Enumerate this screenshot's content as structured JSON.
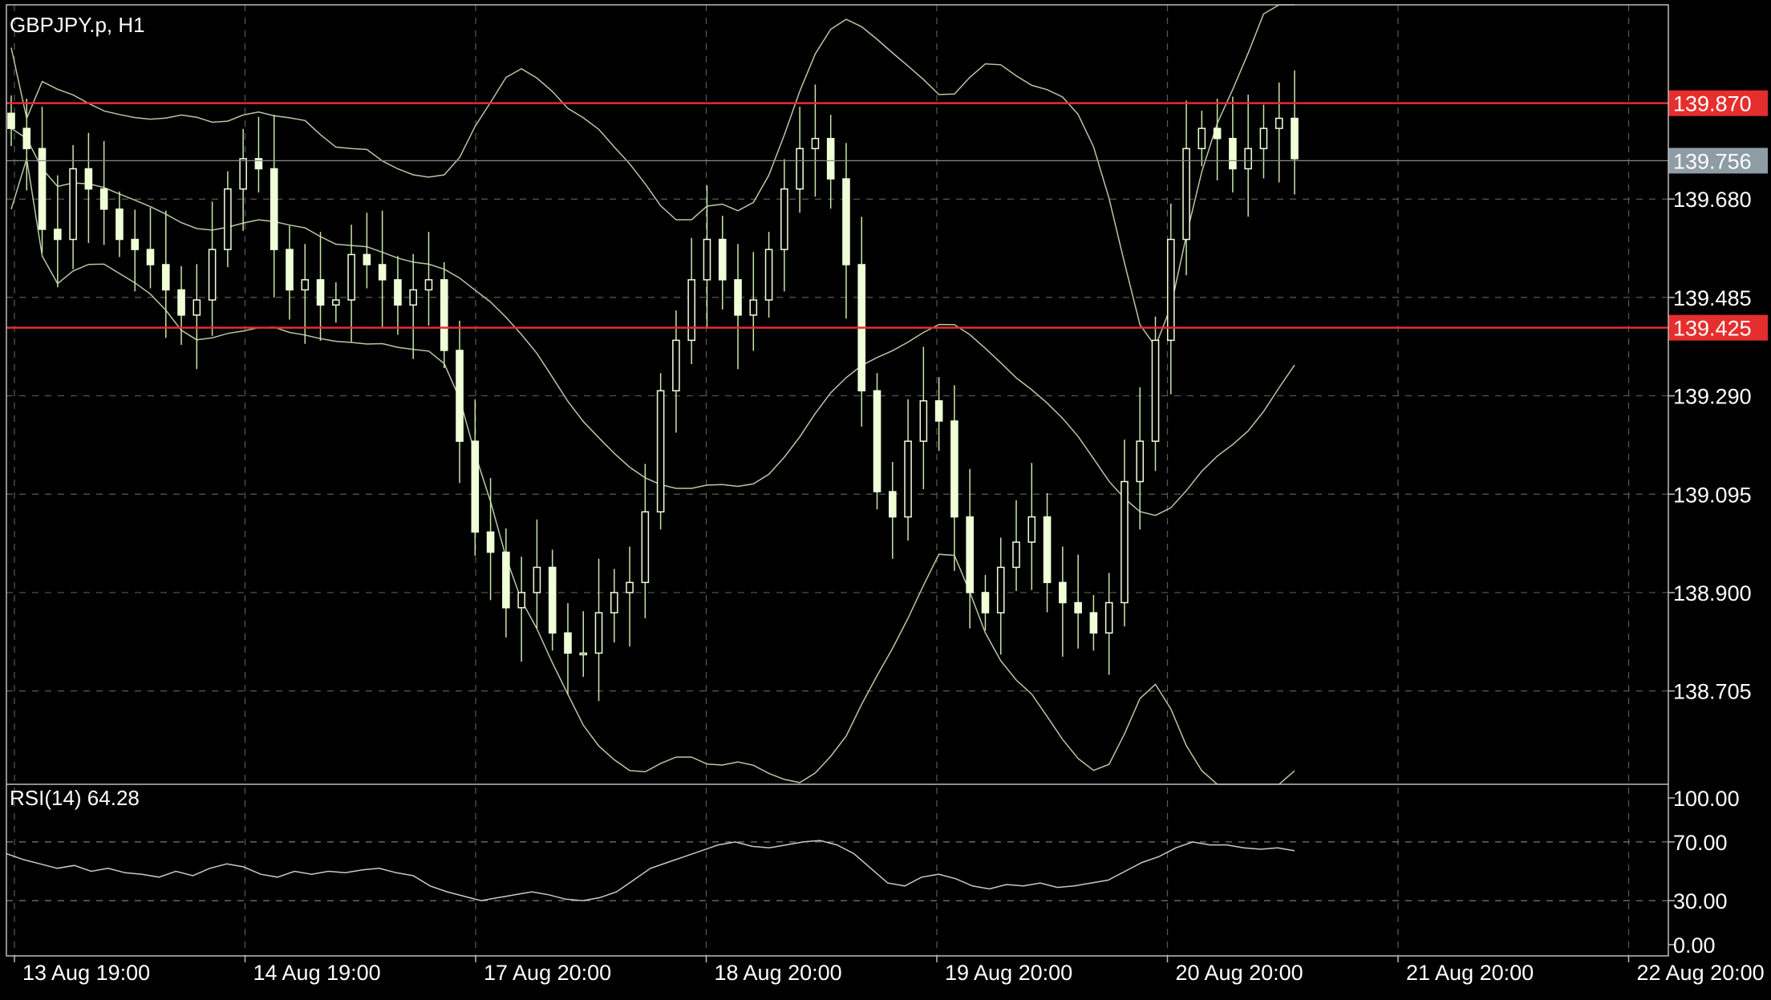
{
  "colors": {
    "background": "#000000",
    "grid": "#5a5a5a",
    "frame": "#bdbdbd",
    "candle": "#f0ffd8",
    "wick": "#c8e6a8",
    "bands": "#b9c7a3",
    "rsi_line": "#c9c9c9",
    "level_line": "#e52e2e",
    "current_tag": "#8e9ca6",
    "axis_text": "#ffffff"
  },
  "chart_data": [
    {
      "type": "candlestick",
      "title": "GBPJPY.p, H1",
      "indicators": [
        "Bollinger Bands"
      ],
      "x_tick_labels": [
        "13 Aug 19:00",
        "14 Aug 19:00",
        "17 Aug 20:00",
        "18 Aug 20:00",
        "19 Aug 20:00",
        "20 Aug 20:00",
        "21 Aug 20:00",
        "22 Aug 20:00"
      ],
      "y_tick_labels": [
        "139.680",
        "139.485",
        "139.290",
        "139.095",
        "138.900",
        "138.705"
      ],
      "ylim": [
        138.52,
        140.065
      ],
      "horizontal_levels": [
        {
          "label": "139.870",
          "value": 139.87
        },
        {
          "label": "139.425",
          "value": 139.425
        }
      ],
      "current_price": {
        "label": "139.756",
        "value": 139.756
      },
      "grid": true,
      "series": [
        {
          "name": "",
          "description_points": "approximate closing path of hourly candles",
          "close": [
            139.82,
            139.78,
            139.62,
            139.6,
            139.74,
            139.7,
            139.66,
            139.6,
            139.58,
            139.55,
            139.5,
            139.45,
            139.48,
            139.58,
            139.7,
            139.76,
            139.74,
            139.58,
            139.5,
            139.52,
            139.47,
            139.48,
            139.57,
            139.55,
            139.52,
            139.47,
            139.5,
            139.52,
            139.38,
            139.2,
            139.02,
            138.98,
            138.87,
            138.9,
            138.95,
            138.82,
            138.78,
            138.78,
            138.86,
            138.9,
            138.92,
            139.06,
            139.3,
            139.4,
            139.52,
            139.6,
            139.52,
            139.45,
            139.48,
            139.58,
            139.7,
            139.78,
            139.8,
            139.72,
            139.55,
            139.3,
            139.1,
            139.05,
            139.2,
            139.28,
            139.24,
            139.05,
            138.9,
            138.86,
            138.95,
            139.0,
            139.05,
            138.92,
            138.88,
            138.86,
            138.82,
            138.88,
            139.12,
            139.2,
            139.4,
            139.6,
            139.78,
            139.82,
            139.8,
            139.74,
            139.78,
            139.82,
            139.84,
            139.76
          ]
        }
      ]
    },
    {
      "type": "line",
      "title": "RSI(14) 64.28",
      "ylim": [
        0,
        100
      ],
      "y_tick_labels": [
        "100.00",
        "70.00",
        "30.00",
        "0.00"
      ],
      "levels": [
        70,
        30
      ],
      "series": [
        {
          "name": "",
          "values": [
            62,
            58,
            55,
            52,
            54,
            50,
            52,
            49,
            48,
            46,
            50,
            47,
            52,
            55,
            53,
            48,
            46,
            50,
            48,
            50,
            49,
            51,
            52,
            49,
            47,
            40,
            36,
            33,
            30,
            32,
            34,
            36,
            34,
            31,
            30,
            32,
            36,
            44,
            52,
            56,
            60,
            64,
            68,
            70,
            67,
            66,
            68,
            70,
            71,
            68,
            62,
            52,
            42,
            40,
            46,
            48,
            45,
            40,
            38,
            41,
            40,
            42,
            39,
            40,
            42,
            44,
            50,
            56,
            60,
            66,
            70,
            68,
            68,
            66,
            65,
            66,
            64
          ]
        }
      ]
    }
  ]
}
